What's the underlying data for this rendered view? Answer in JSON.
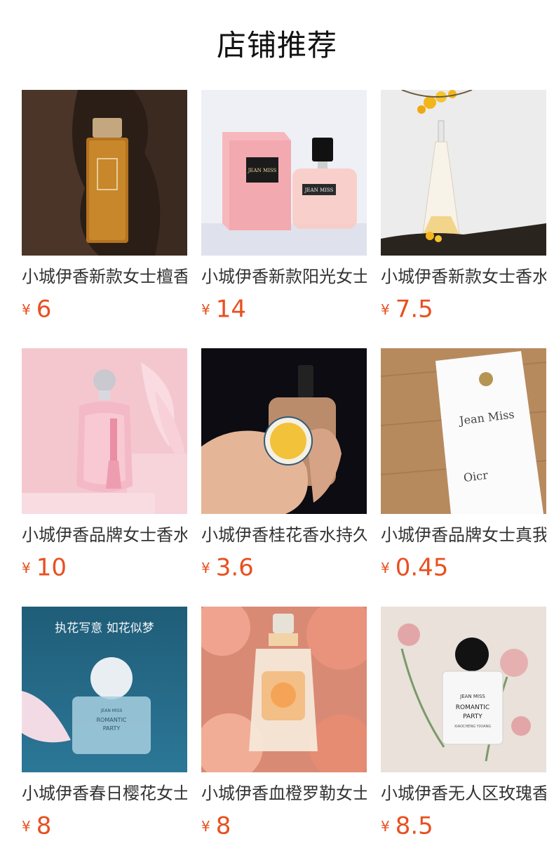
{
  "page": {
    "title": "店铺推荐"
  },
  "currency_symbol": "¥",
  "products": [
    {
      "name": "小城伊香新款女士檀香香水",
      "price": "6"
    },
    {
      "name": "小城伊香新款阳光女士香水",
      "price": "14"
    },
    {
      "name": "小城伊香新款女士香水月下桂花",
      "price": "7.5"
    },
    {
      "name": "小城伊香品牌女士香水",
      "price": "10"
    },
    {
      "name": "小城伊香桂花香水持久",
      "price": "3.6"
    },
    {
      "name": "小城伊香品牌女士真我香水",
      "price": "0.45"
    },
    {
      "name": "小城伊香春日樱花女士香水",
      "price": "8",
      "image_text": {
        "headline": "执花写意 如花似梦",
        "brand": "JEAN MISS",
        "line1": "ROMANTIC",
        "line2": "PARTY"
      }
    },
    {
      "name": "小城伊香血橙罗勒女士香水",
      "price": "8"
    },
    {
      "name": "小城伊香无人区玫瑰香水",
      "price": "8.5",
      "image_text": {
        "brand": "JEAN MISS",
        "line1": "ROMANTIC",
        "line2": "PARTY",
        "line3": "XIAOCHENG YIXIANG"
      }
    }
  ],
  "image_labels": {
    "p2_box": "JEAN MISS",
    "p2_bottle": "JEAN MISS",
    "p6_box_title": "Jean Miss",
    "p6_box_sub": "Oicr"
  }
}
